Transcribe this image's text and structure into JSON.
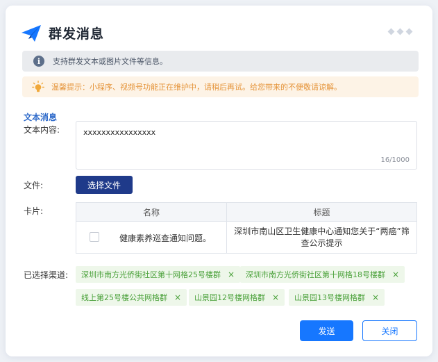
{
  "dialog": {
    "title": "群发消息",
    "title_icon": "paper-plane-icon",
    "accent_color": "#1677ff"
  },
  "info": {
    "icon": "info-icon",
    "icon_glyph": "i",
    "text": "支持群发文本或图片文件等信息。"
  },
  "warning": {
    "icon": "lightbulb-icon",
    "text": "温馨提示：小程序、视频号功能正在维护中，请稍后再试。给您带来的不便敬请谅解。",
    "color": "#e5943a"
  },
  "form": {
    "section_title": "文本消息",
    "content_label": "文本内容:",
    "content_value": "xxxxxxxxxxxxxxxx",
    "content_count": "16/1000",
    "file_label": "文件:",
    "choose_file_button": "选择文件",
    "card_label": "卡片:",
    "channels_label": "已选择渠道:"
  },
  "card_table": {
    "headers": [
      "名称",
      "标题"
    ],
    "rows": [
      {
        "name": "健康素养巡查通知问题。",
        "title": "深圳市南山区卫生健康中心通知您关于“两癌”筛查公示提示",
        "checked": false
      }
    ]
  },
  "channels": [
    {
      "label": "深圳市南方光侨街社区第十网格25号楼群",
      "remove": "×"
    },
    {
      "label": "深圳市南方光侨街社区第十网格18号楼群",
      "remove": "×"
    },
    {
      "label": "线上第25号楼公共网格群",
      "remove": "×"
    },
    {
      "label": "山景园12号楼网格群",
      "remove": "×"
    },
    {
      "label": "山景园13号楼网格群",
      "remove": "×"
    }
  ],
  "footer": {
    "send_button": "发送",
    "close_button": "关闭"
  }
}
